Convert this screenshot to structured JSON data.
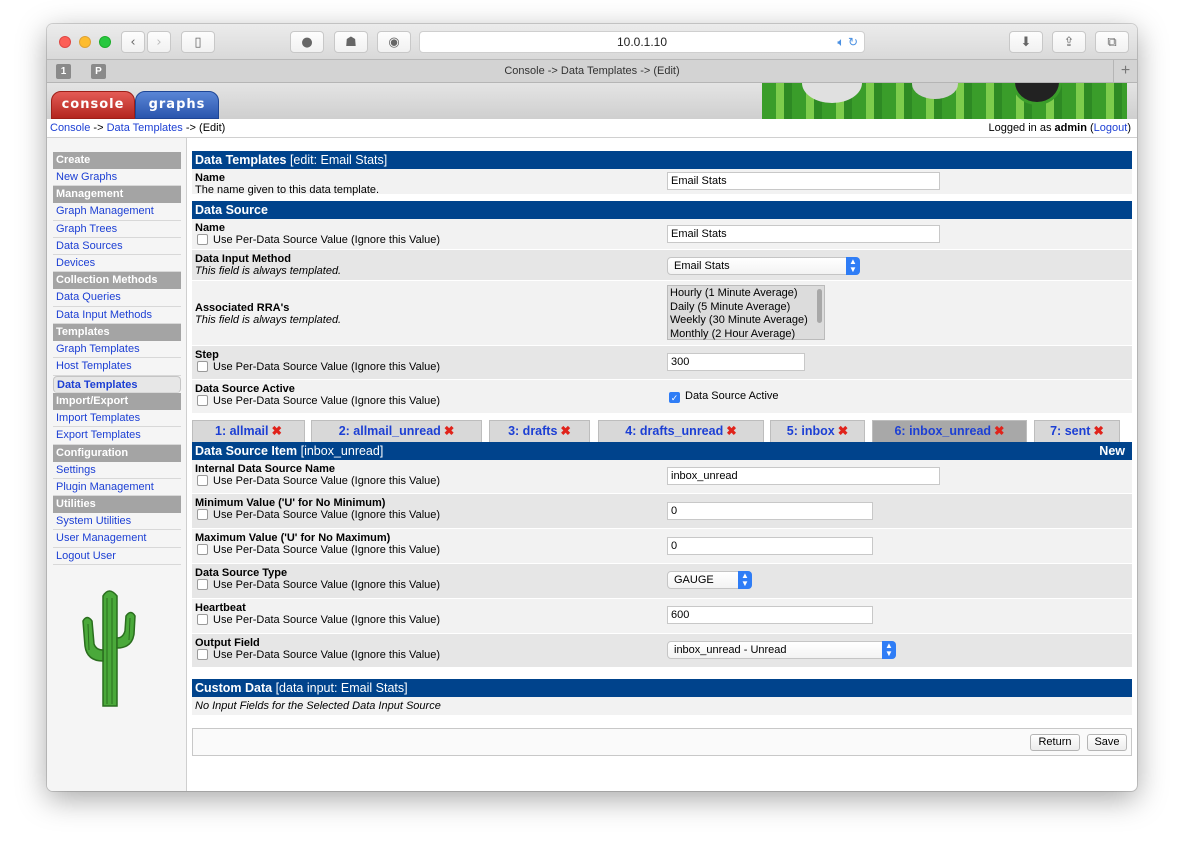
{
  "browser": {
    "address": "10.0.1.10",
    "tab_title": "Console -> Data Templates -> (Edit)",
    "pinned_tabs": [
      "1",
      "P"
    ],
    "new_tab": "+"
  },
  "cacti_nav": {
    "console_label": "console",
    "graphs_label": "graphs"
  },
  "breadcrumb": {
    "console": "Console",
    "sep1": "->",
    "data_templates": "Data Templates",
    "sep2": "->",
    "current": "(Edit)",
    "logged_prefix": "Logged in as",
    "user": "admin",
    "logout": "Logout"
  },
  "sidebar": [
    {
      "type": "header",
      "label": "Create"
    },
    {
      "type": "item",
      "label": "New Graphs"
    },
    {
      "type": "header",
      "label": "Management"
    },
    {
      "type": "item",
      "label": "Graph Management"
    },
    {
      "type": "item",
      "label": "Graph Trees"
    },
    {
      "type": "item",
      "label": "Data Sources"
    },
    {
      "type": "item",
      "label": "Devices"
    },
    {
      "type": "header",
      "label": "Collection Methods"
    },
    {
      "type": "item",
      "label": "Data Queries"
    },
    {
      "type": "item",
      "label": "Data Input Methods"
    },
    {
      "type": "header",
      "label": "Templates"
    },
    {
      "type": "item",
      "label": "Graph Templates"
    },
    {
      "type": "item",
      "label": "Host Templates"
    },
    {
      "type": "item",
      "label": "Data Templates",
      "selected": true
    },
    {
      "type": "header",
      "label": "Import/Export"
    },
    {
      "type": "item",
      "label": "Import Templates"
    },
    {
      "type": "item",
      "label": "Export Templates"
    },
    {
      "type": "header",
      "label": "Configuration"
    },
    {
      "type": "item",
      "label": "Settings"
    },
    {
      "type": "item",
      "label": "Plugin Management"
    },
    {
      "type": "header",
      "label": "Utilities"
    },
    {
      "type": "item",
      "label": "System Utilities"
    },
    {
      "type": "item",
      "label": "User Management"
    },
    {
      "type": "item",
      "label": "Logout User"
    }
  ],
  "template_section": {
    "title": "Data Templates",
    "subtitle": "[edit: Email Stats]",
    "name_label": "Name",
    "name_desc": "The name given to this data template.",
    "name_value": "Email Stats"
  },
  "data_source": {
    "title": "Data Source",
    "per_ds_label": "Use Per-Data Source Value (Ignore this Value)",
    "name_label": "Name",
    "name_value": "Email Stats",
    "input_method_label": "Data Input Method",
    "always_templated": "This field is always templated.",
    "input_method_value": "Email Stats",
    "rra_label": "Associated RRA's",
    "rra_options": [
      "Hourly (1 Minute Average)",
      "Daily (5 Minute Average)",
      "Weekly (30 Minute Average)",
      "Monthly (2 Hour Average)"
    ],
    "step_label": "Step",
    "step_value": "300",
    "active_label": "Data Source Active",
    "active_check_label": "Data Source Active",
    "active_checked": true
  },
  "ds_tabs": [
    {
      "label": "1: allmail",
      "x": "✖"
    },
    {
      "label": "2: allmail_unread",
      "x": "✖"
    },
    {
      "label": "3: drafts",
      "x": "✖"
    },
    {
      "label": "4: drafts_unread",
      "x": "✖"
    },
    {
      "label": "5: inbox",
      "x": "✖"
    },
    {
      "label": "6: inbox_unread",
      "x": "✖",
      "active": true
    },
    {
      "label": "7: sent",
      "x": "✖"
    }
  ],
  "ds_item": {
    "title": "Data Source Item",
    "subtitle": "[inbox_unread]",
    "new_label": "New",
    "per_ds_label": "Use Per-Data Source Value (Ignore this Value)",
    "internal_name_label": "Internal Data Source Name",
    "internal_name_value": "inbox_unread",
    "min_label": "Minimum Value ('U' for No Minimum)",
    "min_value": "0",
    "max_label": "Maximum Value ('U' for No Maximum)",
    "max_value": "0",
    "type_label": "Data Source Type",
    "type_value": "GAUGE",
    "heartbeat_label": "Heartbeat",
    "heartbeat_value": "600",
    "output_label": "Output Field",
    "output_value": "inbox_unread - Unread"
  },
  "custom_data": {
    "title": "Custom Data",
    "subtitle": "[data input: Email Stats]",
    "message": "No Input Fields for the Selected Data Input Source"
  },
  "buttons": {
    "return_label": "Return",
    "save_label": "Save"
  }
}
